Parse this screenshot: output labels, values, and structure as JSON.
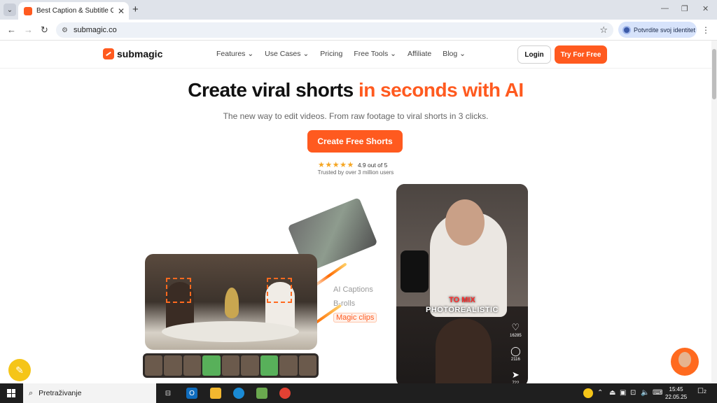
{
  "browser": {
    "tab_title": "Best Caption & Subtitle Genera",
    "url": "submagic.co",
    "identity_label": "Potvrdite svoj identitet"
  },
  "site": {
    "logo_text": "submagic",
    "nav": [
      "Features",
      "Use Cases",
      "Pricing",
      "Free Tools",
      "Affiliate",
      "Blog"
    ],
    "login_label": "Login",
    "try_label": "Try For Free"
  },
  "hero": {
    "title_main": "Create viral shorts ",
    "title_accent": "in seconds with AI",
    "subtitle": "The new way to edit videos. From raw footage to viral shorts in 3 clicks.",
    "cta_label": "Create Free Shorts",
    "stars": "★★★★★",
    "rating_text": "4.9 out of 5",
    "trusted_text": "Trusted by over 3 million users"
  },
  "features": [
    "AI Captions",
    "B-rolls",
    "Magic clips"
  ],
  "phone": {
    "caption_red": "TO MIX",
    "caption_main": "PHOTOREALISTIC",
    "likes": "16285",
    "comments": "2116",
    "shares": "722"
  },
  "taskbar": {
    "search_placeholder": "Pretraživanje",
    "time": "15:45",
    "date": "22.05.25",
    "notifications": "2"
  },
  "colors": {
    "brand": "#ff5a1f",
    "star": "#f5a623"
  }
}
